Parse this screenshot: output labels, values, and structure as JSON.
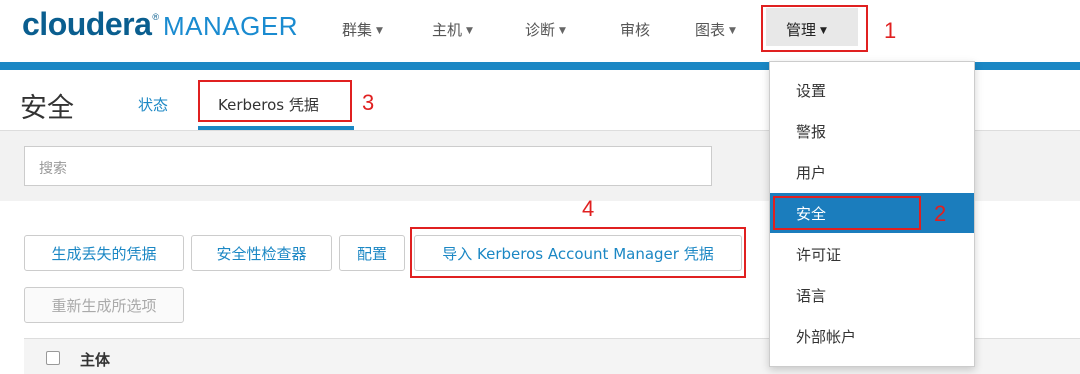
{
  "brand": {
    "name": "cloudera",
    "sup": "®",
    "product": "MANAGER"
  },
  "nav": {
    "items": [
      {
        "label": "群集"
      },
      {
        "label": "主机"
      },
      {
        "label": "诊断"
      },
      {
        "label": "审核"
      },
      {
        "label": "图表"
      }
    ],
    "admin_label": "管理"
  },
  "page": {
    "title": "安全",
    "tabs": {
      "status": "状态",
      "kerberos": "Kerberos 凭据"
    }
  },
  "search": {
    "placeholder": "搜索"
  },
  "actions": {
    "generate_missing": "生成丢失的凭据",
    "security_inspector": "安全性检查器",
    "config": "配置",
    "import_kerberos": "导入 Kerberos Account Manager 凭据",
    "regenerate_selected": "重新生成所选项"
  },
  "table": {
    "header_principal": "主体"
  },
  "admin_menu": {
    "items": [
      "设置",
      "警报",
      "用户",
      "安全",
      "许可证",
      "语言",
      "外部帐户"
    ],
    "active": "安全"
  },
  "annotations": {
    "n1": "1",
    "n2": "2",
    "n3": "3",
    "n4": "4",
    "color": "#e02020"
  },
  "colors": {
    "accent": "#1b87c4",
    "menu_active": "#1b7dbd"
  }
}
